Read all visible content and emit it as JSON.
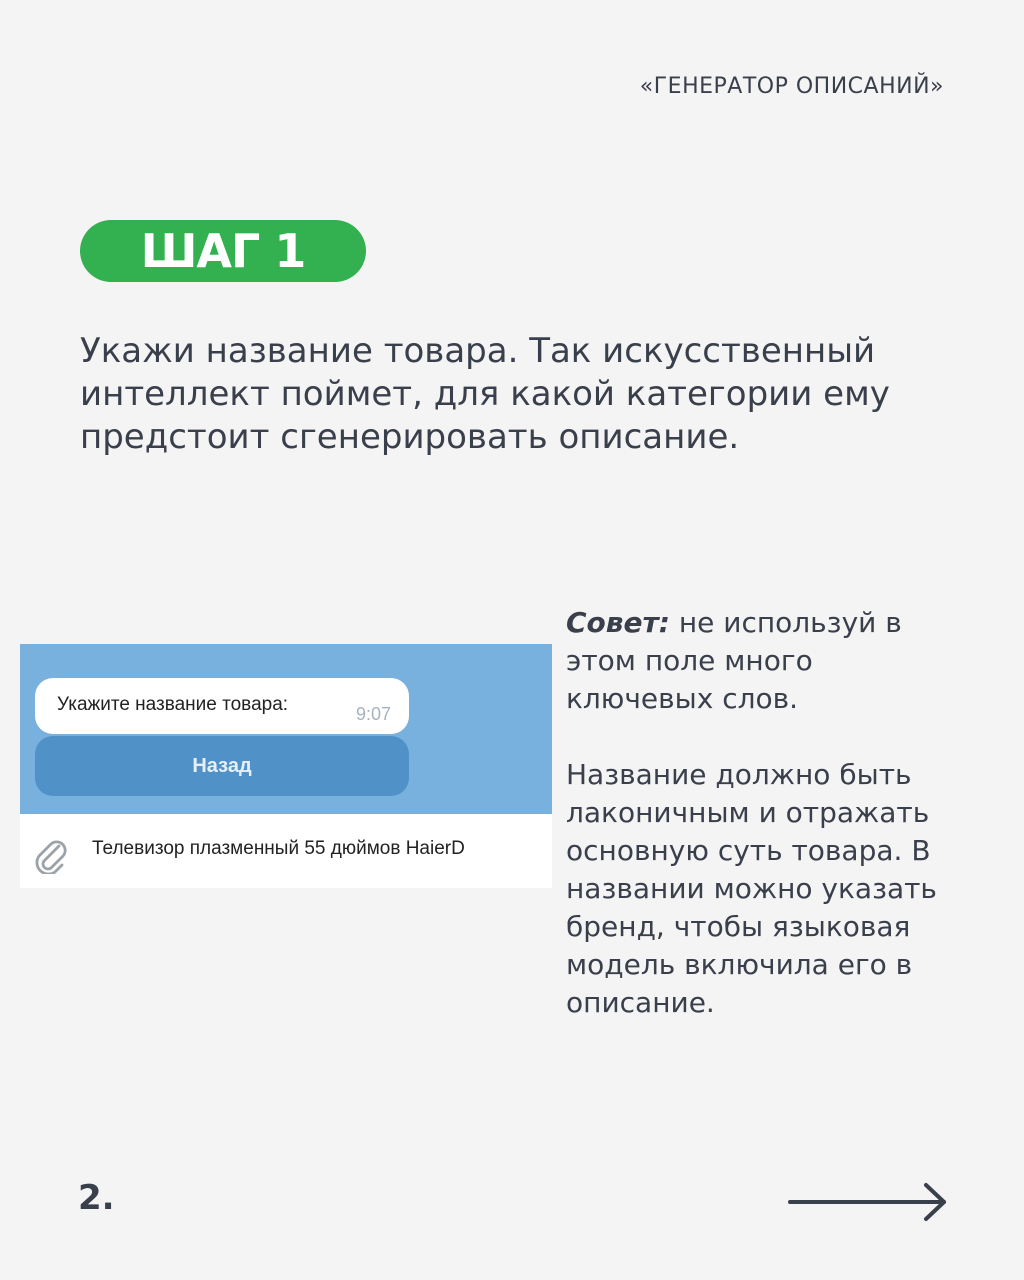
{
  "header": {
    "brand": "«ГЕНЕРАТОР ОПИСАНИЙ»"
  },
  "step": {
    "label": "ШАГ 1"
  },
  "intro": {
    "text": "Укажи название товара. Так искусственный интеллект поймет, для какой категории ему предстоит сгенерировать описание."
  },
  "mockup": {
    "message": {
      "text": "Укажите название товара:",
      "time": "9:07"
    },
    "back_button": "Назад",
    "input": {
      "value": "Телевизор плазменный 55 дюймов HaierD",
      "icon": "paperclip-icon"
    }
  },
  "tips": {
    "tip_label": "Совет:",
    "tip_text": " не используй в этом поле много ключевых слов.",
    "paragraph": "Название должно быть лаконичным и отражать основную суть товара. В названии можно указать бренд, чтобы языковая модель включила его в описание."
  },
  "footer": {
    "page_number": "2.",
    "next_icon": "arrow-right-icon"
  },
  "colors": {
    "badge": "#33b04f",
    "chat_background": "#78b1de",
    "button": "#5092c7",
    "text": "#3a3f4c",
    "page_background": "#f4f4f4"
  }
}
